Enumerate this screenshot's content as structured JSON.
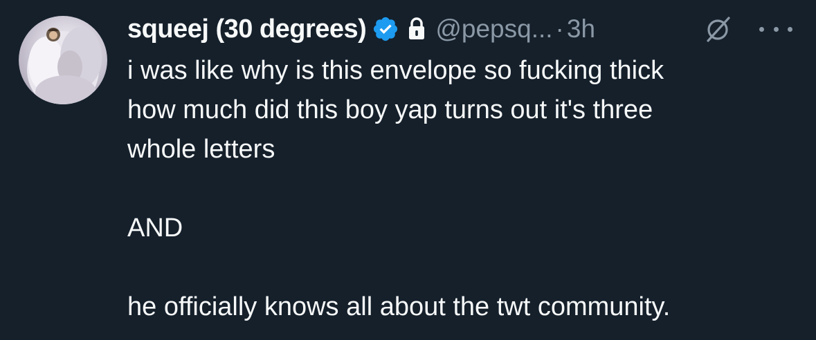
{
  "tweet": {
    "display_name": "squeej (30 degrees)",
    "handle": "@pepsq...",
    "separator": "·",
    "time": "3h",
    "body_lines": [
      "i was like why is this envelope so fucking thick",
      "how much did this boy yap turns out it's three",
      "whole letters",
      "",
      "AND",
      "",
      "he officially knows all about the twt community."
    ]
  },
  "icons": {
    "verified": "verified-badge-icon",
    "lock": "lock-icon",
    "grok": "grok-icon",
    "more": "more-icon"
  },
  "colors": {
    "background": "#15202b",
    "text_primary": "#f7f9f9",
    "text_secondary": "#8b98a5",
    "verified_blue": "#1d9bf0"
  }
}
